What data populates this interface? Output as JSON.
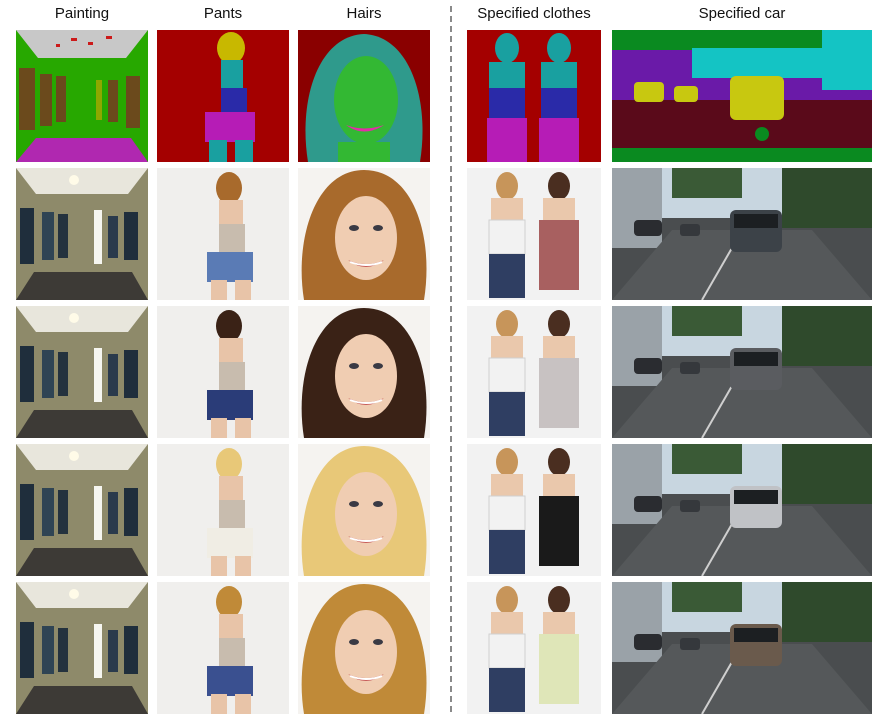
{
  "columns": [
    {
      "key": "painting",
      "label": "Painting",
      "palette": {
        "seg_ceiling": "#c8c8c8",
        "seg_wall": "#27a800",
        "seg_door": "#6b4a1c",
        "wall": "#8f8a6c",
        "floor": "#3f3c37"
      }
    },
    {
      "key": "pants",
      "label": "Pants",
      "palette": {
        "seg_bg": "#a40000",
        "seg_hair": "#c8b800",
        "seg_skin": "#19a0a0",
        "seg_top": "#2a2aa8",
        "seg_pants": "#b61cb6"
      }
    },
    {
      "key": "hairs",
      "label": "Hairs",
      "palette": {
        "seg_bg": "#8a0000",
        "seg_hair": "#2f9a8c",
        "seg_face": "#33b833",
        "seg_lips": "#e12fa5"
      }
    },
    {
      "key": "specified_clothes",
      "label": "Specified clothes",
      "palette": {
        "seg_bg": "#a40000",
        "seg_skin": "#19a0a0",
        "seg_top": "#2a2aa8",
        "seg_bottom": "#b61cb6"
      }
    },
    {
      "key": "specified_car",
      "label": "Specified car",
      "palette": {
        "seg_sky": "#14c4c4",
        "seg_building": "#6a1aa8",
        "seg_car": "#c8c810",
        "seg_road": "#5a0a1a",
        "seg_veg": "#0a8a20"
      }
    }
  ],
  "rows": [
    {
      "kind": "segmentation_map"
    },
    {
      "kind": "generated",
      "variant": 1,
      "colors": {
        "hair": "#a86a2c",
        "pants": "#5a7bb5",
        "cloth_a": "#f2f2f2",
        "cloth_b": "#a86060",
        "car": "#3c4248"
      }
    },
    {
      "kind": "generated",
      "variant": 2,
      "colors": {
        "hair": "#3a2216",
        "pants": "#2a3c78",
        "cloth_a": "#f2f2f2",
        "cloth_b": "#c8c2c2",
        "car": "#5a5c60"
      }
    },
    {
      "kind": "generated",
      "variant": 3,
      "colors": {
        "hair": "#e8c878",
        "pants": "#f0ede4",
        "cloth_a": "#f2f2f2",
        "cloth_b": "#1a1a1a",
        "car": "#c0c2c6"
      }
    },
    {
      "kind": "generated",
      "variant": 4,
      "colors": {
        "hair": "#c08a38",
        "pants": "#3a5090",
        "cloth_a": "#f2f2f2",
        "cloth_b": "#dfe6b8",
        "car": "#6a5a4c"
      }
    }
  ]
}
